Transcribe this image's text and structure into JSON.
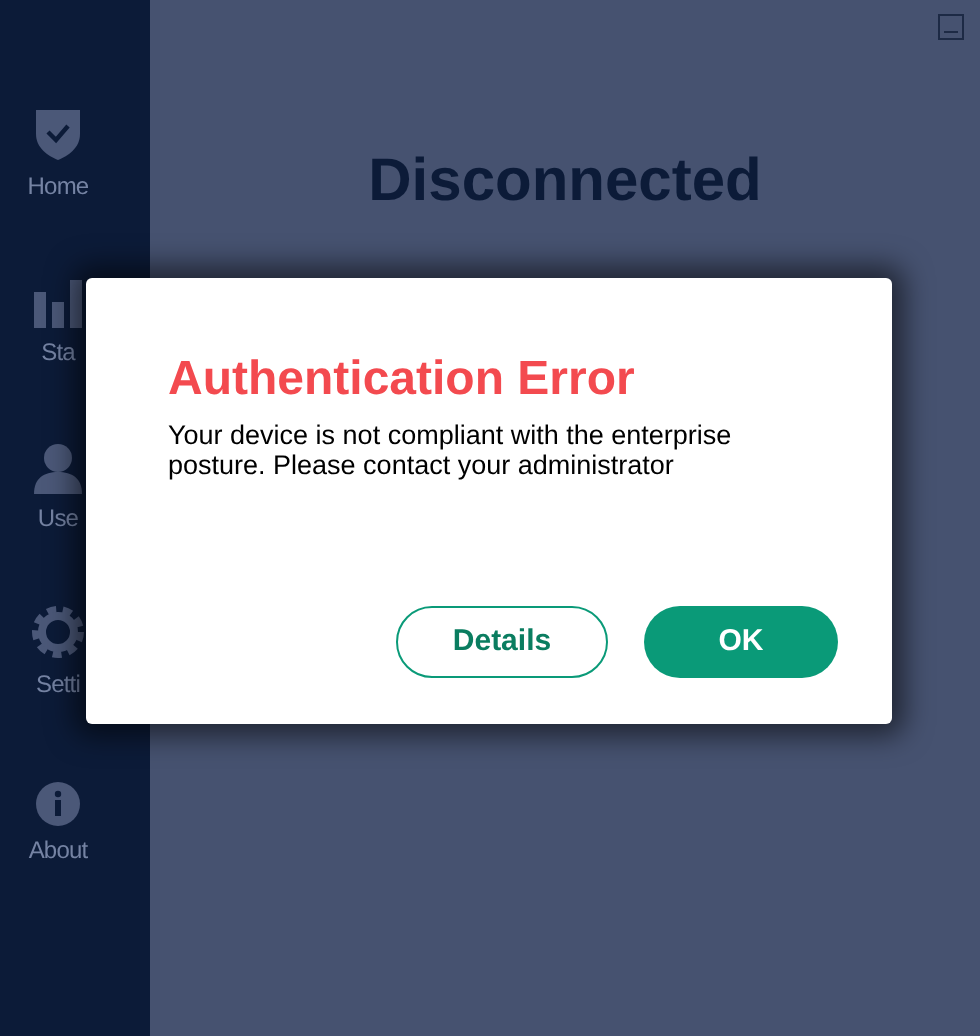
{
  "sidebar": {
    "items": [
      {
        "kind": "shield",
        "label": "Home"
      },
      {
        "kind": "bars",
        "label": "Sta"
      },
      {
        "kind": "user",
        "label": "Use"
      },
      {
        "kind": "gear",
        "label": "Setti"
      },
      {
        "kind": "info",
        "label": "About"
      }
    ]
  },
  "main": {
    "status": "Disconnected"
  },
  "dialog": {
    "title": "Authentication Error",
    "message": "Your device is not compliant with the enterprise posture. Please contact your administrator",
    "buttons": [
      {
        "kind": "outline",
        "label": "Details"
      },
      {
        "kind": "primary",
        "label": "OK"
      }
    ]
  }
}
